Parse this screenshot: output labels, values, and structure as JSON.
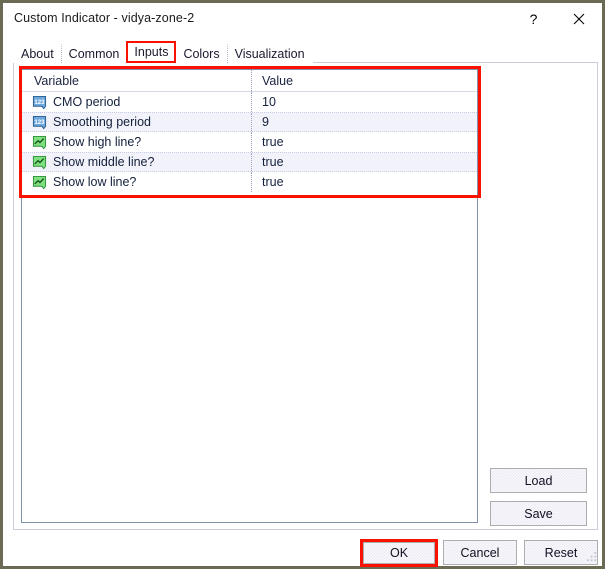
{
  "window": {
    "title": "Custom Indicator - vidya-zone-2",
    "help_button": "?",
    "close_button": "✕"
  },
  "tabs": [
    {
      "label": "About",
      "selected": false
    },
    {
      "label": "Common",
      "selected": false
    },
    {
      "label": "Inputs",
      "selected": true
    },
    {
      "label": "Colors",
      "selected": false
    },
    {
      "label": "Visualization",
      "selected": false
    }
  ],
  "inputs_table": {
    "columns": [
      "Variable",
      "Value"
    ],
    "rows": [
      {
        "icon": "integer-type-icon",
        "variable": "CMO period",
        "value": "10"
      },
      {
        "icon": "integer-type-icon",
        "variable": "Smoothing period",
        "value": "9"
      },
      {
        "icon": "boolean-type-icon",
        "variable": "Show high line?",
        "value": "true"
      },
      {
        "icon": "boolean-type-icon",
        "variable": "Show middle line?",
        "value": "true"
      },
      {
        "icon": "boolean-type-icon",
        "variable": "Show low line?",
        "value": "true"
      }
    ]
  },
  "side_buttons": {
    "load": "Load",
    "save": "Save"
  },
  "dialog_buttons": {
    "ok": "OK",
    "cancel": "Cancel",
    "reset": "Reset"
  },
  "highlights": {
    "accent_color": "#fb1100",
    "selected_tab": "Inputs",
    "highlighted_button": "OK"
  }
}
